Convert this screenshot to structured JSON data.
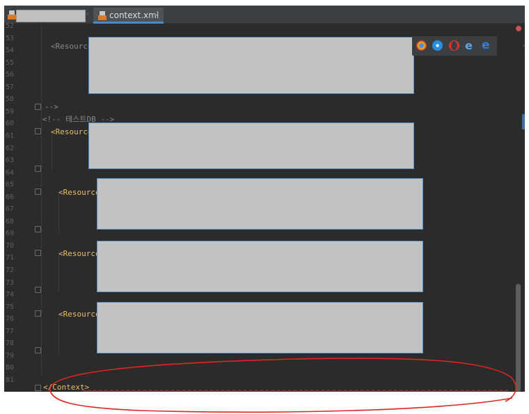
{
  "tabs": [
    {
      "name": "",
      "icon": "xml-file-icon"
    },
    {
      "name": "context.xml",
      "icon": "xml-file-icon",
      "close": "×"
    }
  ],
  "line_numbers": [
    "52",
    "53",
    "54",
    "55",
    "56",
    "57",
    "58",
    "59",
    "60",
    "61",
    "62",
    "63",
    "64",
    "65",
    "66",
    "67",
    "68",
    "69",
    "70",
    "71",
    "72",
    "73",
    "74",
    "75",
    "76",
    "77",
    "78",
    "79",
    "80",
    "81"
  ],
  "code": {
    "line53": "<Resource",
    "line58": "-->",
    "line59": "<!-- 테스트DB -->",
    "line60": "<Resource",
    "line65": "<Resource",
    "line70": "<Resource",
    "line75": "<Resource",
    "line81": "</Context>"
  },
  "browser_icons": [
    "chrome-icon",
    "safari-icon",
    "opera-icon",
    "internet-explorer-icon",
    "edge-icon"
  ],
  "colors": {
    "editor_bg": "#2b2b2b",
    "tag": "#e8bf6a",
    "comment": "#8a8a8a",
    "annotation": "#e0261e",
    "redaction": "#c2c2c2"
  }
}
